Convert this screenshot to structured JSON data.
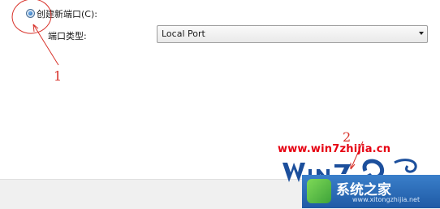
{
  "port_option": {
    "label": "创建新端口(C):",
    "selected": true
  },
  "port_type": {
    "label": "端口类型:",
    "value": "Local Port"
  },
  "annotations": {
    "marker_1": "1",
    "marker_2": "2",
    "color": "#d8322a"
  },
  "watermark": {
    "url": "www.win7zhijia.cn",
    "badge_text": "系统之家",
    "badge_sub": "www.xitongzhijia.net",
    "url_color": "#e60012"
  }
}
